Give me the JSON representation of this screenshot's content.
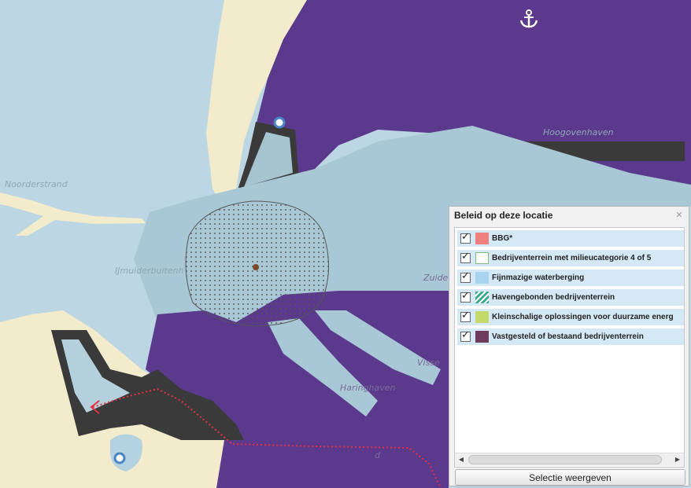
{
  "map": {
    "labels": {
      "haringhaven": "Haringhaven",
      "ijmuiderbuitenhaven": "IJmuiderbuitenh",
      "zuiderhaven": "Zuide",
      "noordpier": "Noorderstrand",
      "visserhaven": "Visse",
      "hoogovenhaven": "Hoogovenhaven",
      "area_d": "d"
    },
    "icons": {
      "anchor": "anchor-icon",
      "marker_top": "location-marker-icon",
      "marker_bottom": "location-marker-icon",
      "center_point": "selection-center-icon"
    },
    "colors": {
      "water": "#b4d3e0",
      "sea": "#bcd7e3",
      "sand": "#f3eccc",
      "industrial": "#5b3a8e",
      "quay": "#3a3a3a",
      "route": "#e53040"
    }
  },
  "panel": {
    "title": "Beleid op deze locatie",
    "close_icon": "close-icon",
    "legend": [
      {
        "label": "BBG*",
        "swatch": "#f08080",
        "swatch_border": "#f08080",
        "pattern": "solid"
      },
      {
        "label": "Bedrijventerrein met milieucategorie 4 of 5",
        "swatch": "#ffffff",
        "swatch_border": "#7bbf7b",
        "pattern": "outline"
      },
      {
        "label": "Fijnmazige waterberging",
        "swatch": "#a8d4f0",
        "swatch_border": "#a8d4f0",
        "pattern": "solid"
      },
      {
        "label": "Havengebonden bedrijventerrein",
        "swatch": "#3aa88a",
        "swatch_border": "#3aa88a",
        "pattern": "hatch"
      },
      {
        "label": "Kleinschalige oplossingen voor duurzame energ",
        "swatch": "#c4d96a",
        "swatch_border": "#c4d96a",
        "pattern": "solid"
      },
      {
        "label": "Vastgesteld of bestaand bedrijventerrein",
        "swatch": "#6e3c5a",
        "swatch_border": "#6e3c5a",
        "pattern": "solid"
      }
    ],
    "scroll_left": "◀",
    "scroll_right": "▶",
    "button_label": "Selectie weergeven"
  }
}
